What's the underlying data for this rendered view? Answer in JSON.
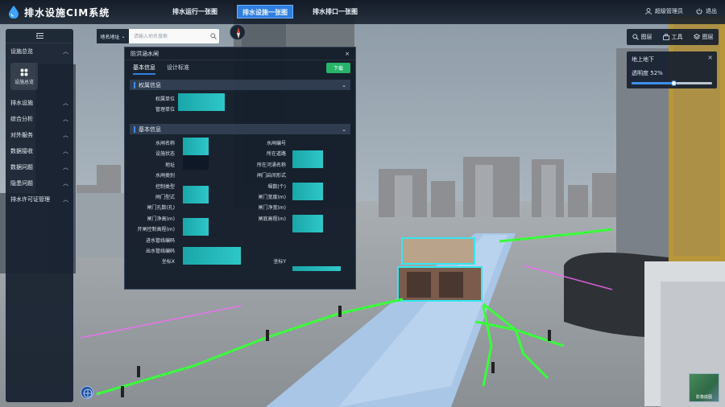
{
  "app": {
    "title": "排水设施CIM系统"
  },
  "topnav": {
    "tabs": [
      {
        "label": "排水运行一张图"
      },
      {
        "label": "排水设施一张图"
      },
      {
        "label": "排水排口一张图"
      }
    ],
    "active_index": 1,
    "user_label": "超级管理员",
    "logout_label": "退出"
  },
  "sidebar": {
    "sections": [
      {
        "label": "设施总览",
        "expanded": true
      },
      {
        "label": "排水设施"
      },
      {
        "label": "综合分析"
      },
      {
        "label": "对外服务"
      },
      {
        "label": "数据接收"
      },
      {
        "label": "数据问题"
      },
      {
        "label": "隐患问题"
      },
      {
        "label": "排水许可证管理"
      }
    ],
    "tile_label": "设施总览"
  },
  "search": {
    "address_label": "地名地址",
    "placeholder": "请输入地名搜索"
  },
  "toolbar": {
    "tool1": "图层",
    "tool2": "工具",
    "tool3": "图层"
  },
  "layer_panel": {
    "title": "地上地下",
    "opacity_label": "透明度",
    "opacity_value": "52%",
    "opacity_fraction": 0.52
  },
  "popup": {
    "title": "防洪涵水闸",
    "tabs": [
      {
        "label": "基本信息"
      },
      {
        "label": "设计标准"
      }
    ],
    "download_label": "下载",
    "sections": [
      {
        "title": "权属信息"
      },
      {
        "title": "基本信息"
      }
    ],
    "ownership_fields": [
      "权属单位",
      "管理单位"
    ],
    "basic_fields_left": [
      "水闸名称",
      "设施状态",
      "地址",
      "水闸类别",
      "控制类型",
      "闸门型式",
      "闸门孔数(孔)",
      "闸门净高(m)",
      "开闸控制高程(m)",
      "进水管线编码",
      "出水管线编码",
      "坐标X"
    ],
    "basic_fields_right": [
      "水闸编号",
      "所在道路",
      "所在河涌名称",
      "闸门启闭形式",
      "堰数(个)",
      "闸门宽度(m)",
      "闸门净宽(m)",
      "闸底高程(m)",
      "坐标Y"
    ]
  },
  "map": {
    "thumb_label": "影像底图"
  },
  "colors": {
    "accent": "#2f7fe0",
    "download": "#27b46a",
    "pipe": "#39ff3a",
    "highlight": "#34e6f0"
  }
}
